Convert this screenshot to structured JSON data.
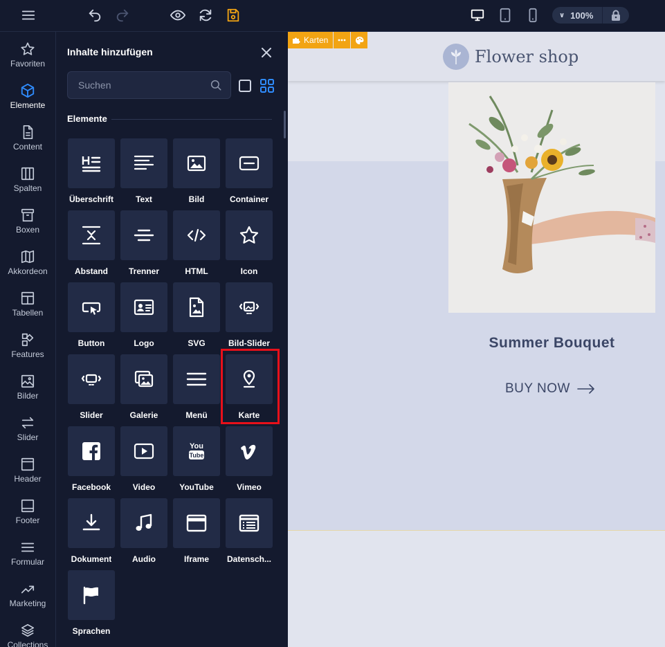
{
  "toolbar": {
    "zoom_level": "100%",
    "accent_color": "#f2a413"
  },
  "rail": [
    {
      "label": "Favoriten",
      "icon": "star-icon"
    },
    {
      "label": "Elemente",
      "icon": "cube-icon"
    },
    {
      "label": "Content",
      "icon": "document-icon"
    },
    {
      "label": "Spalten",
      "icon": "columns-icon"
    },
    {
      "label": "Boxen",
      "icon": "archive-box-icon"
    },
    {
      "label": "Akkordeon",
      "icon": "map-fold-icon"
    },
    {
      "label": "Tabellen",
      "icon": "table-icon"
    },
    {
      "label": "Features",
      "icon": "shapes-icon"
    },
    {
      "label": "Bilder",
      "icon": "image-icon"
    },
    {
      "label": "Slider",
      "icon": "arrows-swap-icon"
    },
    {
      "label": "Header",
      "icon": "header-layout-icon"
    },
    {
      "label": "Footer",
      "icon": "footer-layout-icon"
    },
    {
      "label": "Formular",
      "icon": "list-lines-icon"
    },
    {
      "label": "Marketing",
      "icon": "trend-up-icon"
    },
    {
      "label": "Collections",
      "icon": "layers-icon"
    }
  ],
  "panel": {
    "title": "Inhalte hinzufügen",
    "search_placeholder": "Suchen",
    "section_label": "Elemente",
    "elements": [
      {
        "label": "Überschrift",
        "icon": "heading-icon"
      },
      {
        "label": "Text",
        "icon": "text-lines-icon"
      },
      {
        "label": "Bild",
        "icon": "image-icon"
      },
      {
        "label": "Container",
        "icon": "container-icon"
      },
      {
        "label": "Abstand",
        "icon": "spacing-icon"
      },
      {
        "label": "Trenner",
        "icon": "divider-icon"
      },
      {
        "label": "HTML",
        "icon": "code-icon"
      },
      {
        "label": "Icon",
        "icon": "star-icon"
      },
      {
        "label": "Button",
        "icon": "button-click-icon"
      },
      {
        "label": "Logo",
        "icon": "id-card-icon"
      },
      {
        "label": "SVG",
        "icon": "svg-file-icon"
      },
      {
        "label": "Bild-Slider",
        "icon": "image-slider-icon"
      },
      {
        "label": "Slider",
        "icon": "slider-icon"
      },
      {
        "label": "Galerie",
        "icon": "gallery-icon"
      },
      {
        "label": "Menü",
        "icon": "menu-icon"
      },
      {
        "label": "Karte",
        "icon": "map-pin-icon"
      },
      {
        "label": "Facebook",
        "icon": "facebook-icon"
      },
      {
        "label": "Video",
        "icon": "video-play-icon"
      },
      {
        "label": "YouTube",
        "icon": "youtube-icon"
      },
      {
        "label": "Vimeo",
        "icon": "vimeo-icon"
      },
      {
        "label": "Dokument",
        "icon": "download-icon"
      },
      {
        "label": "Audio",
        "icon": "music-note-icon"
      },
      {
        "label": "Iframe",
        "icon": "iframe-window-icon"
      },
      {
        "label": "Datensch...",
        "icon": "privacy-list-icon"
      },
      {
        "label": "Sprachen",
        "icon": "flag-icon"
      }
    ]
  },
  "canvas": {
    "badge_label": "Karten",
    "brand": "Flower shop",
    "product_title": "Summer Bouquet",
    "cta": "BUY NOW"
  }
}
